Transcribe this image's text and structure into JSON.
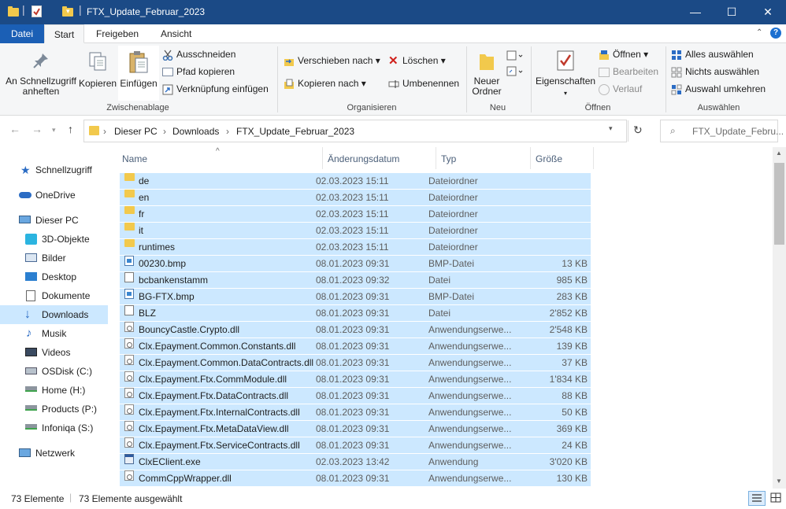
{
  "window": {
    "title": "FTX_Update_Februar_2023",
    "minimize": "—",
    "maximize": "☐",
    "close": "✕"
  },
  "menu": {
    "tabs": [
      "Datei",
      "Start",
      "Freigeben",
      "Ansicht"
    ],
    "active": "Start"
  },
  "ribbon": {
    "clipboard": {
      "pin": "An Schnellzugriff anheften",
      "copy": "Kopieren",
      "paste": "Einfügen",
      "cut": "Ausschneiden",
      "copy_path": "Pfad kopieren",
      "paste_shortcut": "Verknüpfung einfügen",
      "label": "Zwischenablage"
    },
    "organize": {
      "move_to": "Verschieben nach",
      "copy_to": "Kopieren nach",
      "delete": "Löschen",
      "rename": "Umbenennen",
      "label": "Organisieren"
    },
    "new": {
      "new_folder": "Neuer Ordner",
      "label": "Neu"
    },
    "open": {
      "properties": "Eigenschaften",
      "open": "Öffnen",
      "edit": "Bearbeiten",
      "history": "Verlauf",
      "label": "Öffnen"
    },
    "select": {
      "select_all": "Alles auswählen",
      "select_none": "Nichts auswählen",
      "invert": "Auswahl umkehren",
      "label": "Auswählen"
    }
  },
  "address": {
    "crumbs": [
      "Dieser PC",
      "Downloads",
      "FTX_Update_Februar_2023"
    ],
    "search_placeholder": "FTX_Update_Febru..."
  },
  "sidebar": {
    "items": [
      {
        "label": "Schnellzugriff",
        "icon": "star-icon"
      },
      {
        "label": "OneDrive",
        "icon": "cloud-icon"
      },
      {
        "label": "Dieser PC",
        "icon": "computer-icon"
      },
      {
        "label": "3D-Objekte",
        "icon": "cube-icon"
      },
      {
        "label": "Bilder",
        "icon": "pictures-icon"
      },
      {
        "label": "Desktop",
        "icon": "desktop-icon"
      },
      {
        "label": "Dokumente",
        "icon": "documents-icon"
      },
      {
        "label": "Downloads",
        "icon": "download-icon"
      },
      {
        "label": "Musik",
        "icon": "music-icon"
      },
      {
        "label": "Videos",
        "icon": "video-icon"
      },
      {
        "label": "OSDisk (C:)",
        "icon": "drive-icon"
      },
      {
        "label": "Home (H:)",
        "icon": "network-drive-icon"
      },
      {
        "label": "Products (P:)",
        "icon": "network-drive-icon"
      },
      {
        "label": "Infoniqa (S:)",
        "icon": "network-drive-icon"
      },
      {
        "label": "Netzwerk",
        "icon": "network-icon"
      }
    ],
    "selected": "Downloads"
  },
  "columns": {
    "name": "Name",
    "date": "Änderungsdatum",
    "type": "Typ",
    "size": "Größe"
  },
  "files": [
    {
      "name": "de",
      "date": "02.03.2023 15:11",
      "type": "Dateiordner",
      "size": "",
      "kind": "folder"
    },
    {
      "name": "en",
      "date": "02.03.2023 15:11",
      "type": "Dateiordner",
      "size": "",
      "kind": "folder"
    },
    {
      "name": "fr",
      "date": "02.03.2023 15:11",
      "type": "Dateiordner",
      "size": "",
      "kind": "folder"
    },
    {
      "name": "it",
      "date": "02.03.2023 15:11",
      "type": "Dateiordner",
      "size": "",
      "kind": "folder"
    },
    {
      "name": "runtimes",
      "date": "02.03.2023 15:11",
      "type": "Dateiordner",
      "size": "",
      "kind": "folder"
    },
    {
      "name": "00230.bmp",
      "date": "08.01.2023 09:31",
      "type": "BMP-Datei",
      "size": "13 KB",
      "kind": "bmp"
    },
    {
      "name": "bcbankenstamm",
      "date": "08.01.2023 09:32",
      "type": "Datei",
      "size": "985 KB",
      "kind": "file"
    },
    {
      "name": "BG-FTX.bmp",
      "date": "08.01.2023 09:31",
      "type": "BMP-Datei",
      "size": "283 KB",
      "kind": "bmp"
    },
    {
      "name": "BLZ",
      "date": "08.01.2023 09:31",
      "type": "Datei",
      "size": "2'852 KB",
      "kind": "file"
    },
    {
      "name": "BouncyCastle.Crypto.dll",
      "date": "08.01.2023 09:31",
      "type": "Anwendungserwe...",
      "size": "2'548 KB",
      "kind": "dll"
    },
    {
      "name": "Clx.Epayment.Common.Constants.dll",
      "date": "08.01.2023 09:31",
      "type": "Anwendungserwe...",
      "size": "139 KB",
      "kind": "dll"
    },
    {
      "name": "Clx.Epayment.Common.DataContracts.dll",
      "date": "08.01.2023 09:31",
      "type": "Anwendungserwe...",
      "size": "37 KB",
      "kind": "dll"
    },
    {
      "name": "Clx.Epayment.Ftx.CommModule.dll",
      "date": "08.01.2023 09:31",
      "type": "Anwendungserwe...",
      "size": "1'834 KB",
      "kind": "dll"
    },
    {
      "name": "Clx.Epayment.Ftx.DataContracts.dll",
      "date": "08.01.2023 09:31",
      "type": "Anwendungserwe...",
      "size": "88 KB",
      "kind": "dll"
    },
    {
      "name": "Clx.Epayment.Ftx.InternalContracts.dll",
      "date": "08.01.2023 09:31",
      "type": "Anwendungserwe...",
      "size": "50 KB",
      "kind": "dll"
    },
    {
      "name": "Clx.Epayment.Ftx.MetaDataView.dll",
      "date": "08.01.2023 09:31",
      "type": "Anwendungserwe...",
      "size": "369 KB",
      "kind": "dll"
    },
    {
      "name": "Clx.Epayment.Ftx.ServiceContracts.dll",
      "date": "08.01.2023 09:31",
      "type": "Anwendungserwe...",
      "size": "24 KB",
      "kind": "dll"
    },
    {
      "name": "ClxEClient.exe",
      "date": "02.03.2023 13:42",
      "type": "Anwendung",
      "size": "3'020 KB",
      "kind": "exe"
    },
    {
      "name": "CommCppWrapper.dll",
      "date": "08.01.2023 09:31",
      "type": "Anwendungserwe...",
      "size": "130 KB",
      "kind": "dll"
    }
  ],
  "status": {
    "count": "73 Elemente",
    "selected": "73 Elemente ausgewählt"
  },
  "colors": {
    "titlebar": "#1b4a86",
    "selection": "#cce8ff",
    "file_tab": "#1b5fb5"
  }
}
